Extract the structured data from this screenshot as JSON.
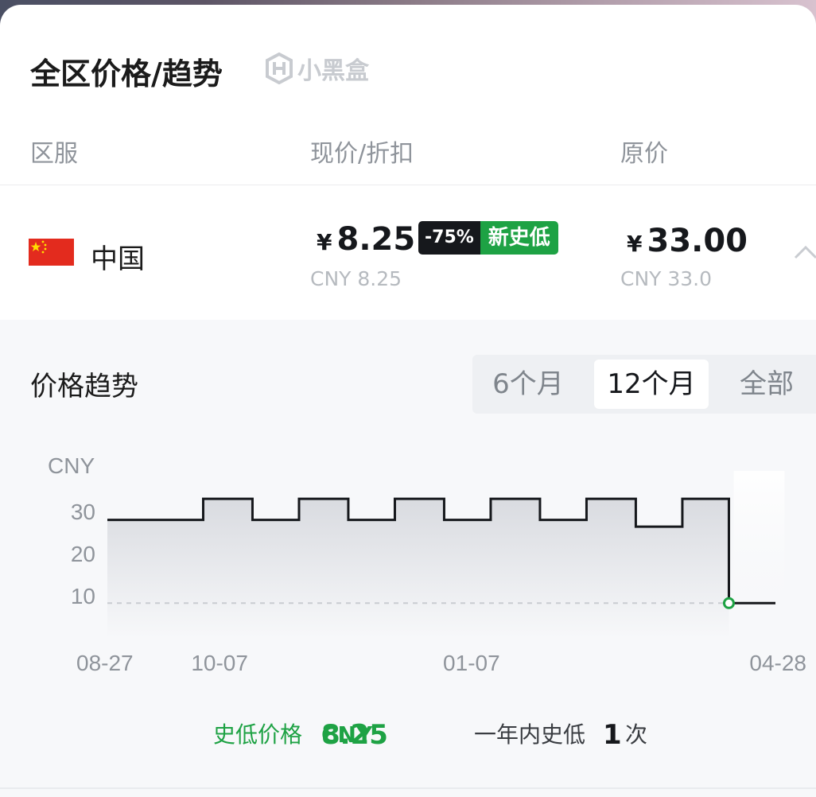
{
  "header": {
    "title": "全区价格/趋势",
    "brand": "小黑盒"
  },
  "columns": {
    "region": "区服",
    "current": "现价/折扣",
    "original": "原价"
  },
  "row": {
    "region_name": "中国",
    "flag": "china-flag",
    "currency_symbol": "¥",
    "current_price": "8.25",
    "current_price_sub": "CNY 8.25",
    "discount": "-75%",
    "tag": "新史低",
    "original_price": "33.00",
    "original_price_sub": "CNY 33.0",
    "expand_icon": "chevron-up-icon"
  },
  "trend": {
    "title": "价格趋势",
    "tabs": [
      "6个月",
      "12个月",
      "全部"
    ],
    "selected_tab": "12个月"
  },
  "chart_data": {
    "type": "line",
    "step": "after",
    "ylabel": "CNY",
    "yticks": [
      30,
      20,
      10
    ],
    "ylim": [
      0,
      38
    ],
    "xticks": [
      {
        "label": "08-27",
        "x": 0
      },
      {
        "label": "10-07",
        "x": 41
      },
      {
        "label": "01-07",
        "x": 133
      },
      {
        "label": "04-28",
        "x": 244
      }
    ],
    "x_domain": [
      0,
      244
    ],
    "series": [
      {
        "points": [
          {
            "x": 0,
            "y": 28
          },
          {
            "x": 35,
            "y": 33
          },
          {
            "x": 53,
            "y": 28
          },
          {
            "x": 70,
            "y": 33
          },
          {
            "x": 88,
            "y": 28
          },
          {
            "x": 105,
            "y": 33
          },
          {
            "x": 123,
            "y": 28
          },
          {
            "x": 140,
            "y": 33
          },
          {
            "x": 158,
            "y": 28
          },
          {
            "x": 175,
            "y": 33
          },
          {
            "x": 193,
            "y": 26.4
          },
          {
            "x": 210,
            "y": 33
          },
          {
            "x": 227,
            "y": 8.25
          },
          {
            "x": 244,
            "y": 8.25
          }
        ]
      }
    ],
    "low_reference": 8.25,
    "colors": {
      "line": "#16181c",
      "low_marker": "#1ea244",
      "reference": "#c9ccd1"
    }
  },
  "summary": {
    "low_label": "史低价格",
    "low_currency": "CNY",
    "low_value": "8.25",
    "count_label": "一年内史低",
    "count": "1",
    "count_unit": "次"
  },
  "colors": {
    "accent_green": "#1ea244",
    "text_dark": "#16181c",
    "muted": "#8f949b"
  }
}
